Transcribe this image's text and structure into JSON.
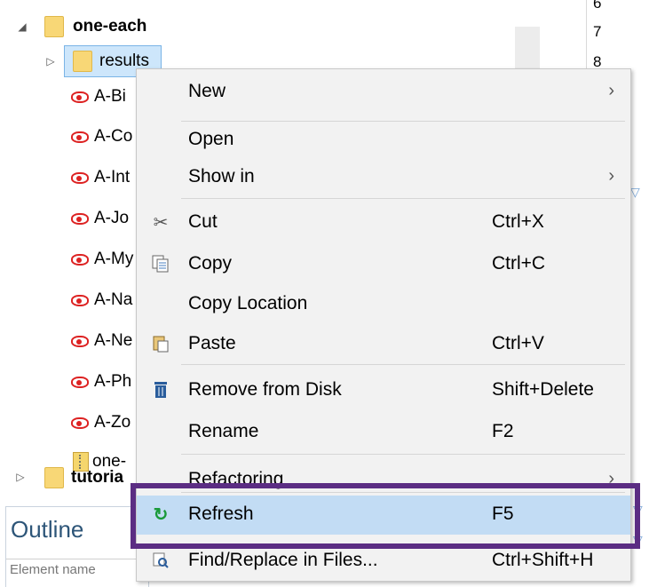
{
  "tree": {
    "project": "one-each",
    "folder": "results",
    "files": [
      "A-Bi",
      "A-Co",
      "A-Int",
      "A-Jo",
      "A-My",
      "A-Na",
      "A-Ne",
      "A-Ph",
      "A-Zo"
    ],
    "zip_file": "one-",
    "sibling": "tutoria"
  },
  "line_numbers": [
    "6",
    "7",
    "8"
  ],
  "outline": {
    "title": "Outline",
    "filter_placeholder": "Element name"
  },
  "menu": {
    "new": "New",
    "open": "Open",
    "show_in": "Show in",
    "cut": "Cut",
    "cut_acc": "Ctrl+X",
    "copy": "Copy",
    "copy_acc": "Ctrl+C",
    "copy_location": "Copy Location",
    "paste": "Paste",
    "paste_acc": "Ctrl+V",
    "remove": "Remove from Disk",
    "remove_acc": "Shift+Delete",
    "rename": "Rename",
    "rename_acc": "F2",
    "refactoring": "Refactoring",
    "refresh": "Refresh",
    "refresh_acc": "F5",
    "find_replace": "Find/Replace in Files...",
    "find_replace_acc": "Ctrl+Shift+H"
  },
  "colors": {
    "highlight_border": "#5b2d83",
    "menu_hover": "#c2dcf4",
    "refresh_icon": "#1a9a3a"
  },
  "icons": {
    "submenu": "chevron-right-icon",
    "cut": "scissors-icon",
    "copy": "copy-icon",
    "paste": "paste-icon",
    "remove": "trash-icon",
    "refresh": "refresh-icon",
    "find": "find-replace-icon"
  }
}
